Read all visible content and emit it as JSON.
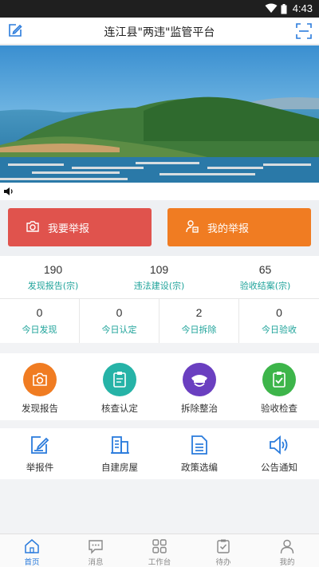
{
  "status_bar": {
    "time": "4:43"
  },
  "header": {
    "title": "连江县\"两违\"监管平台",
    "edit_icon": "edit-icon",
    "scan_icon": "scan-icon"
  },
  "banner": {
    "image": "coastal-landscape-photo"
  },
  "report_buttons": [
    {
      "label": "我要举报",
      "icon": "camera-icon",
      "color": "#e0534d"
    },
    {
      "label": "我的举报",
      "icon": "user-report-icon",
      "color": "#f07c22"
    }
  ],
  "stats": [
    {
      "value": "190",
      "label": "发现报告(宗)"
    },
    {
      "value": "109",
      "label": "违法建设(宗)"
    },
    {
      "value": "65",
      "label": "验收结案(宗)"
    }
  ],
  "today": [
    {
      "value": "0",
      "label": "今日发现"
    },
    {
      "value": "0",
      "label": "今日认定"
    },
    {
      "value": "2",
      "label": "今日拆除"
    },
    {
      "value": "0",
      "label": "今日验收"
    }
  ],
  "functions": [
    {
      "label": "发现报告",
      "icon": "camera-icon",
      "color": "#f07c22"
    },
    {
      "label": "核查认定",
      "icon": "clipboard-icon",
      "color": "#26b3a7"
    },
    {
      "label": "拆除整治",
      "icon": "officer-cap-icon",
      "color": "#6a3fc0"
    },
    {
      "label": "验收检查",
      "icon": "checklist-icon",
      "color": "#3db54a"
    }
  ],
  "tools": [
    {
      "label": "举报件",
      "icon": "edit-document-icon"
    },
    {
      "label": "自建房屋",
      "icon": "building-icon"
    },
    {
      "label": "政策选编",
      "icon": "document-icon"
    },
    {
      "label": "公告通知",
      "icon": "speaker-icon"
    }
  ],
  "tabs": [
    {
      "label": "首页",
      "icon": "home-icon",
      "active": true
    },
    {
      "label": "消息",
      "icon": "message-icon"
    },
    {
      "label": "工作台",
      "icon": "grid-icon"
    },
    {
      "label": "待办",
      "icon": "todo-icon"
    },
    {
      "label": "我的",
      "icon": "person-icon"
    }
  ],
  "colors": {
    "accent": "#2a7bdc",
    "teal_text": "#1ea39a"
  }
}
